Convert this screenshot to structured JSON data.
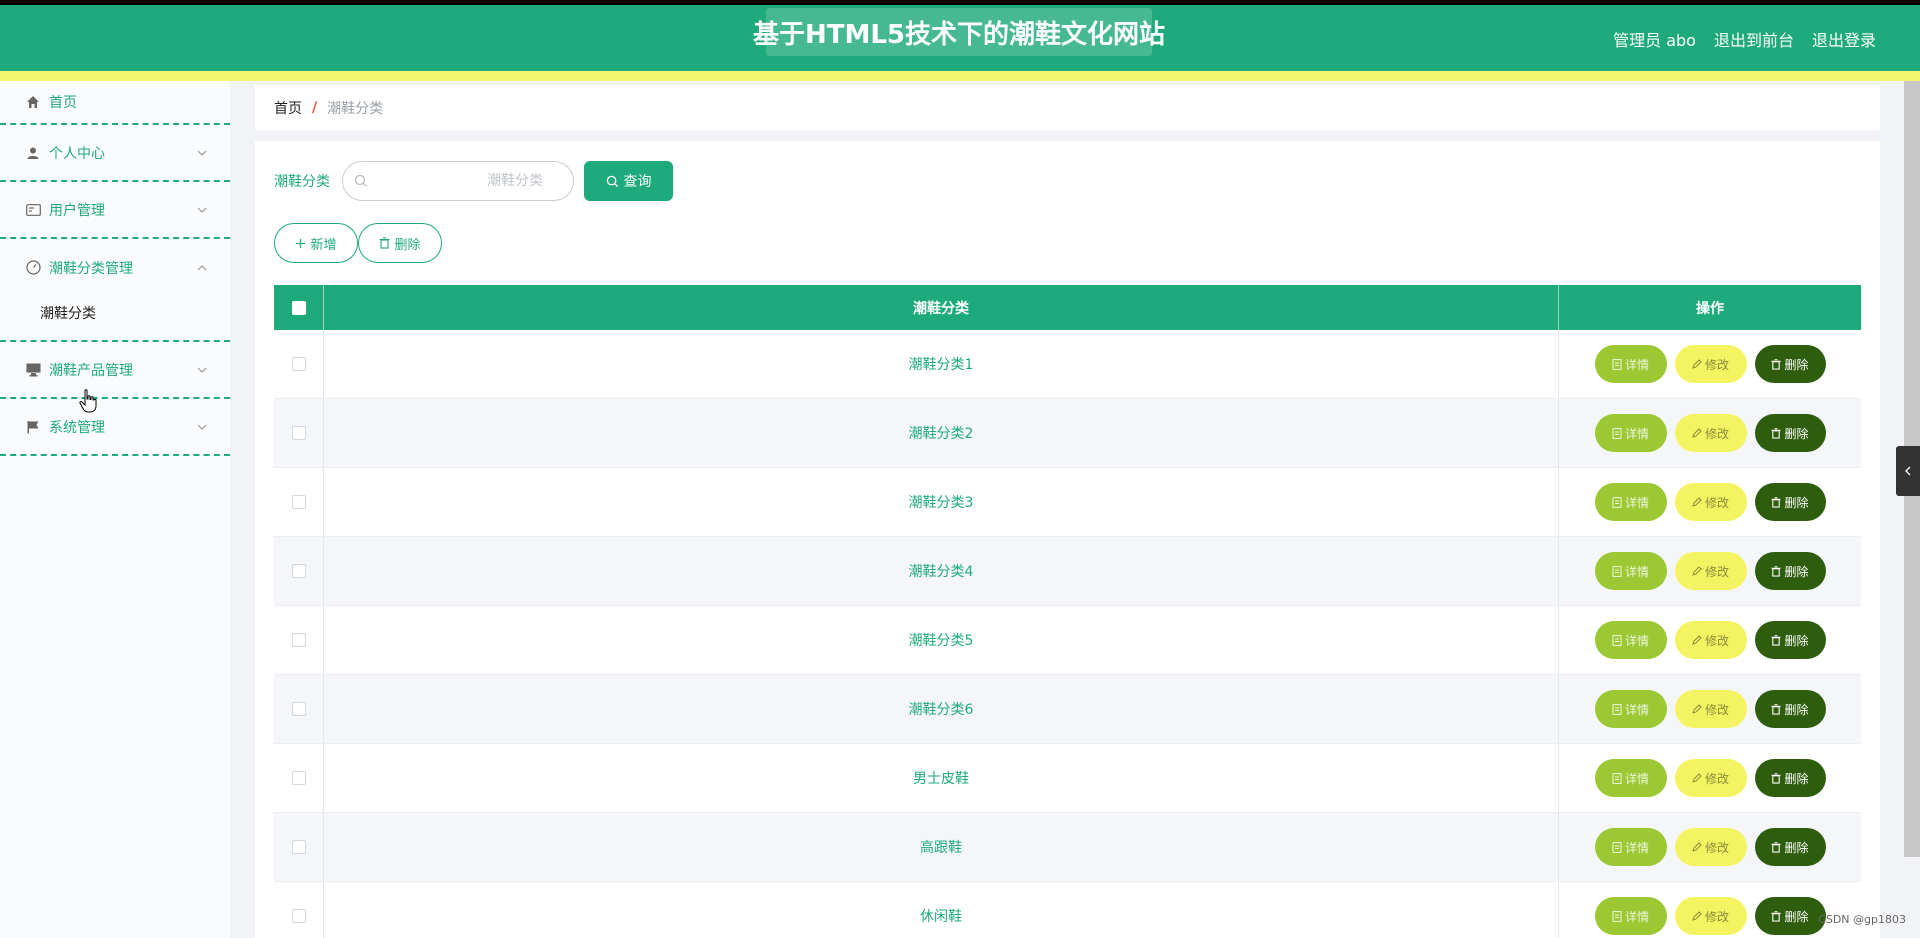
{
  "header": {
    "title": "基于HTML5技术下的潮鞋文化网站",
    "user": "管理员 abo",
    "front_link": "退出到前台",
    "logout": "退出登录"
  },
  "sidebar": {
    "items": [
      {
        "label": "首页",
        "icon": "home-icon"
      },
      {
        "label": "个人中心",
        "icon": "user-icon"
      },
      {
        "label": "用户管理",
        "icon": "id-card-icon"
      },
      {
        "label": "潮鞋分类管理",
        "icon": "dashboard-icon",
        "sub": [
          "潮鞋分类"
        ]
      },
      {
        "label": "潮鞋产品管理",
        "icon": "monitor-icon"
      },
      {
        "label": "系统管理",
        "icon": "flag-icon"
      }
    ]
  },
  "breadcrumb": {
    "home": "首页",
    "separator": "/",
    "current": "潮鞋分类"
  },
  "search": {
    "label": "潮鞋分类",
    "placeholder": "潮鞋分类",
    "button": "查询"
  },
  "actions": {
    "add": "新增",
    "delete": "删除"
  },
  "table": {
    "headers": [
      "潮鞋分类",
      "操作"
    ],
    "rows": [
      "潮鞋分类1",
      "潮鞋分类2",
      "潮鞋分类3",
      "潮鞋分类4",
      "潮鞋分类5",
      "潮鞋分类6",
      "男士皮鞋",
      "高跟鞋",
      "休闲鞋"
    ],
    "row_actions": {
      "detail": "详情",
      "edit": "修改",
      "delete": "删除"
    }
  },
  "watermark": "CSDN @gp1803",
  "colors": {
    "primary": "#1eaa7c",
    "accent_yellow": "#f2f56d",
    "detail": "#9bc833",
    "edit": "#f4f462",
    "delete": "#2e5e0d"
  }
}
